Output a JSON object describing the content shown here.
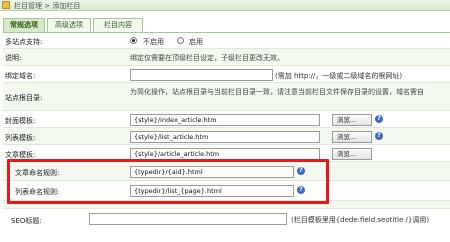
{
  "breadcrumb": "栏目管理 > 添加栏目",
  "tabs": [
    "常规选项",
    "高级选项",
    "栏目内容"
  ],
  "rows": {
    "multisite": {
      "label": "多站点支持:",
      "opt_off": "不启用",
      "opt_on": "启用"
    },
    "note": {
      "label": "说明:",
      "text": "绑定仅需要在顶级栏目设定，子级栏目更改无效。"
    },
    "domain": {
      "label": "绑定域名:",
      "hint": "(需加 http://，一级或二级域名的根网址)"
    },
    "site_root": {
      "label": "站点根目录:",
      "text": "为简化操作，站点根目录与当前栏目目录一致，请注意当前栏目文件保存目录的设置，域名需自"
    },
    "index_tpl": {
      "label": "封面模板:",
      "value": "{style}/index_article.htm",
      "browse": "浏览..."
    },
    "list_tpl": {
      "label": "列表模板:",
      "value": "{style}/list_article.htm",
      "browse": "浏览..."
    },
    "article_tpl": {
      "label": "文章模板:",
      "value": "{style}/article_article.htm",
      "browse": "浏览..."
    },
    "article_rule": {
      "label": "文章命名规则:",
      "value": "{typedir}/{aid}.html"
    },
    "list_rule": {
      "label": "列表命名规则:",
      "value": "{typedir}/list_{page}.html"
    },
    "seo_title": {
      "label": "SEO标题:",
      "hint": "(栏目模板里用{dede:field.seotitle /}调用)"
    }
  },
  "colors": {
    "highlight": "#e8191a",
    "tab_border": "#a8c695",
    "help_icon": "#3f69c8"
  }
}
